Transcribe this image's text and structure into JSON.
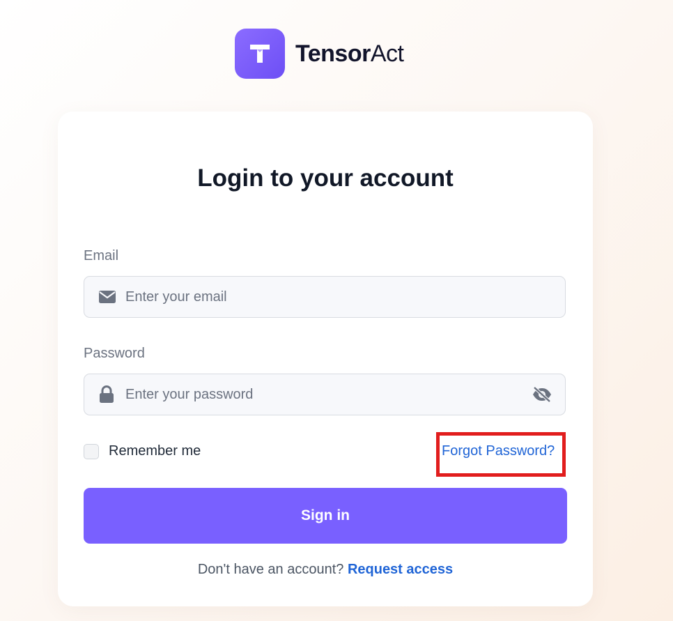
{
  "brand": {
    "name_bold": "Tensor",
    "name_light": "Act",
    "accent_color": "#7960ff",
    "logo_icon": "t-letter-icon"
  },
  "login": {
    "title": "Login to your account",
    "email": {
      "label": "Email",
      "placeholder": "Enter your email",
      "value": "",
      "icon": "envelope-icon"
    },
    "password": {
      "label": "Password",
      "placeholder": "Enter your password",
      "value": "",
      "icon": "lock-icon",
      "toggle_icon": "eye-slash-icon"
    },
    "remember_label": "Remember me",
    "remember_checked": false,
    "forgot_label": "Forgot Password?",
    "signin_label": "Sign in",
    "footer_text": "Don't have an account? ",
    "request_access_label": "Request access",
    "link_color": "#1f64d6",
    "highlight_color": "#e11d1d"
  }
}
